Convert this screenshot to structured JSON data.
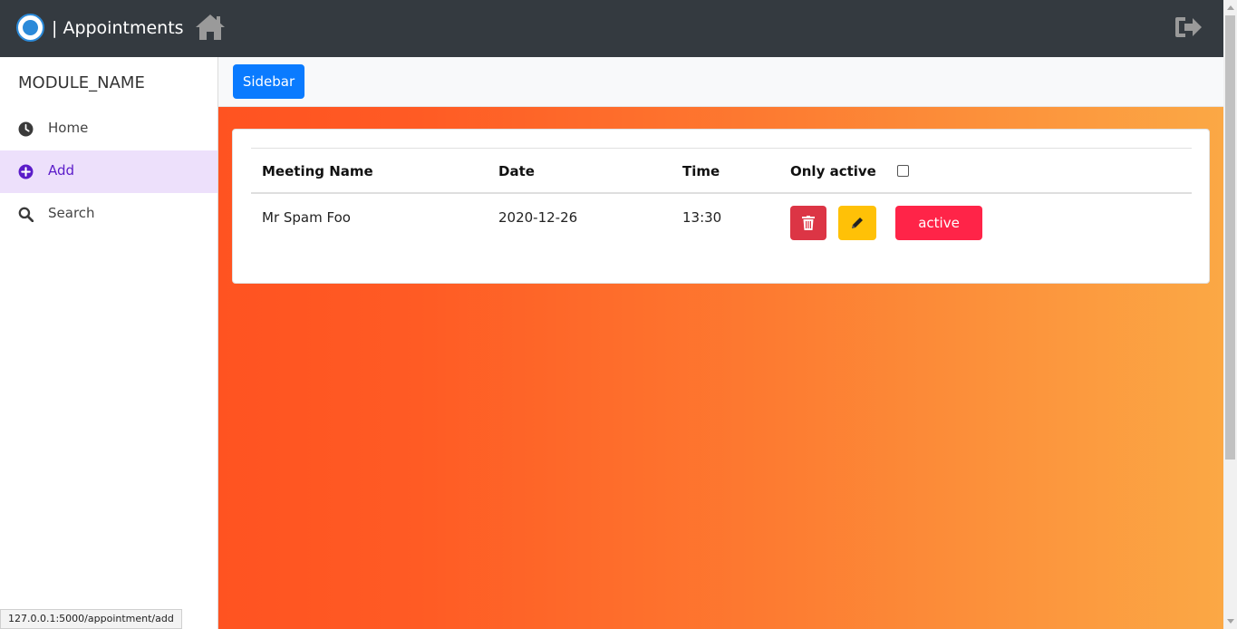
{
  "header": {
    "brand_title": "| Appointments"
  },
  "sidebar": {
    "module_name": "MODULE_NAME",
    "items": [
      {
        "label": "Home",
        "icon": "clock-icon"
      },
      {
        "label": "Add",
        "icon": "plus-circle-icon",
        "active": true
      },
      {
        "label": "Search",
        "icon": "search-icon"
      }
    ]
  },
  "topbar": {
    "sidebar_button": "Sidebar"
  },
  "table": {
    "headers": {
      "meeting_name": "Meeting Name",
      "date": "Date",
      "time": "Time",
      "only_active": "Only active"
    },
    "rows": [
      {
        "meeting_name": "Mr Spam Foo",
        "date": "2020-12-26",
        "time": "13:30",
        "status": "active"
      }
    ]
  },
  "status_bar": {
    "url": "127.0.0.1:5000/appointment/add"
  },
  "colors": {
    "navbar": "#343a40",
    "primary": "#0a7bff",
    "danger": "#dc3545",
    "warning": "#ffc107",
    "active_badge": "#ff2448"
  }
}
